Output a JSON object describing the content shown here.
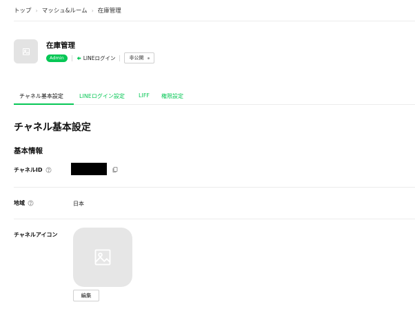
{
  "breadcrumb": {
    "items": [
      "トップ",
      "マッシュ&ルーム",
      "在庫管理"
    ],
    "separator": "›"
  },
  "channel": {
    "name": "在庫管理",
    "role_badge": "Admin",
    "type": "LINEログイン",
    "status": "非公開"
  },
  "tabs": [
    {
      "label": "チャネル基本設定",
      "active": true
    },
    {
      "label": "LINEログイン設定",
      "active": false
    },
    {
      "label": "LIFF",
      "active": false
    },
    {
      "label": "権限設定",
      "active": false
    }
  ],
  "section": {
    "title": "チャネル基本設定"
  },
  "basic_info": {
    "title": "基本情報",
    "channel_id": {
      "label": "チャネルID",
      "value_redacted": true
    },
    "region": {
      "label": "地域",
      "value": "日本"
    },
    "channel_icon": {
      "label": "チャネルアイコン",
      "edit_label": "編集"
    }
  },
  "colors": {
    "accent": "#06c755",
    "placeholder_bg": "#e6e6e6",
    "divider": "#ececec"
  },
  "icons": [
    "image-placeholder-icon",
    "line-login-icon",
    "help-icon",
    "copy-icon"
  ]
}
